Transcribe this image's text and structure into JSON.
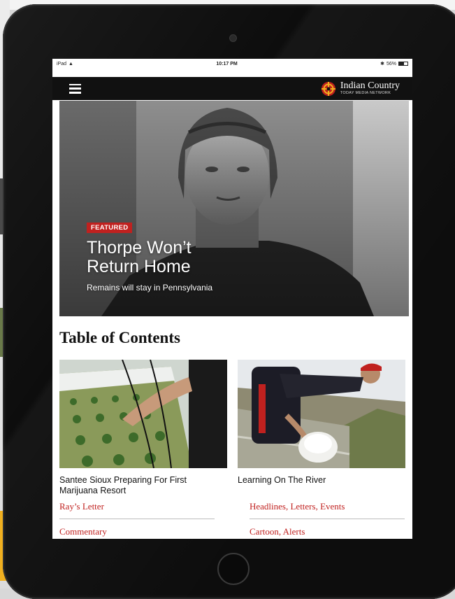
{
  "status_bar": {
    "device": "iPad",
    "time": "10:17 PM",
    "battery": "56%",
    "battery_level": 0.56
  },
  "navbar": {
    "logo_title": "Indian Country",
    "logo_subtitle": "TODAY MEDIA NETWORK"
  },
  "hero": {
    "badge": "FEATURED",
    "title": "Thorpe Won’t Return Home",
    "subtitle": "Remains will stay in Pennsylvania"
  },
  "toc": {
    "heading": "Table of Contents",
    "stories": [
      {
        "caption": "Santee Sioux Preparing For First Marijuana Resort"
      },
      {
        "caption": "Learning On The River"
      }
    ],
    "links": [
      {
        "label": "Ray’s Letter"
      },
      {
        "label": "Headlines, Letters, Events"
      },
      {
        "label": "Commentary"
      },
      {
        "label": "Cartoon, Alerts"
      }
    ]
  },
  "colors": {
    "accent_red": "#c0211f",
    "navbar_bg": "#111111",
    "device_frame": "#0d0d0d"
  }
}
